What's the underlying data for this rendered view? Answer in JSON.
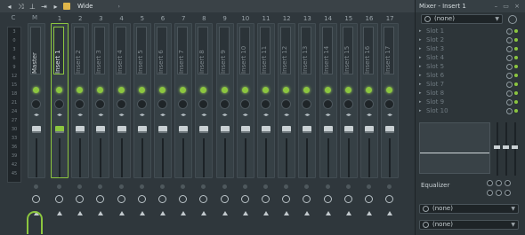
{
  "toolbar": {
    "view_label": "Wide",
    "more": "›"
  },
  "meters": {
    "c_label": "C",
    "m_label": "M",
    "scale": [
      "3",
      "0",
      "3",
      "6",
      "9",
      "12",
      "15",
      "18",
      "21",
      "24",
      "27",
      "30",
      "33",
      "36",
      "39",
      "42",
      "45"
    ]
  },
  "tracks": [
    {
      "num": "",
      "name": "Master"
    },
    {
      "num": "1",
      "name": "Insert 1"
    },
    {
      "num": "2",
      "name": "Insert 2"
    },
    {
      "num": "3",
      "name": "Insert 3"
    },
    {
      "num": "4",
      "name": "Insert 4"
    },
    {
      "num": "5",
      "name": "Insert 5"
    },
    {
      "num": "6",
      "name": "Insert 6"
    },
    {
      "num": "7",
      "name": "Insert 7"
    },
    {
      "num": "8",
      "name": "Insert 8"
    },
    {
      "num": "9",
      "name": "Insert 9"
    },
    {
      "num": "10",
      "name": "Insert 10"
    },
    {
      "num": "11",
      "name": "Insert 11"
    },
    {
      "num": "12",
      "name": "Insert 12"
    },
    {
      "num": "13",
      "name": "Insert 13"
    },
    {
      "num": "14",
      "name": "Insert 14"
    },
    {
      "num": "15",
      "name": "Insert 15"
    },
    {
      "num": "16",
      "name": "Insert 16"
    },
    {
      "num": "17",
      "name": "Insert 17"
    }
  ],
  "side": {
    "title": "Mixer - Insert 1",
    "preset": "(none)",
    "slots": [
      "Slot 1",
      "Slot 2",
      "Slot 3",
      "Slot 4",
      "Slot 5",
      "Slot 6",
      "Slot 7",
      "Slot 8",
      "Slot 9",
      "Slot 10"
    ],
    "eq_label": "Equalizer",
    "input": "(none)",
    "output": "(none)"
  },
  "colors": {
    "accent": "#8cc63f",
    "background": "#2f373c"
  }
}
